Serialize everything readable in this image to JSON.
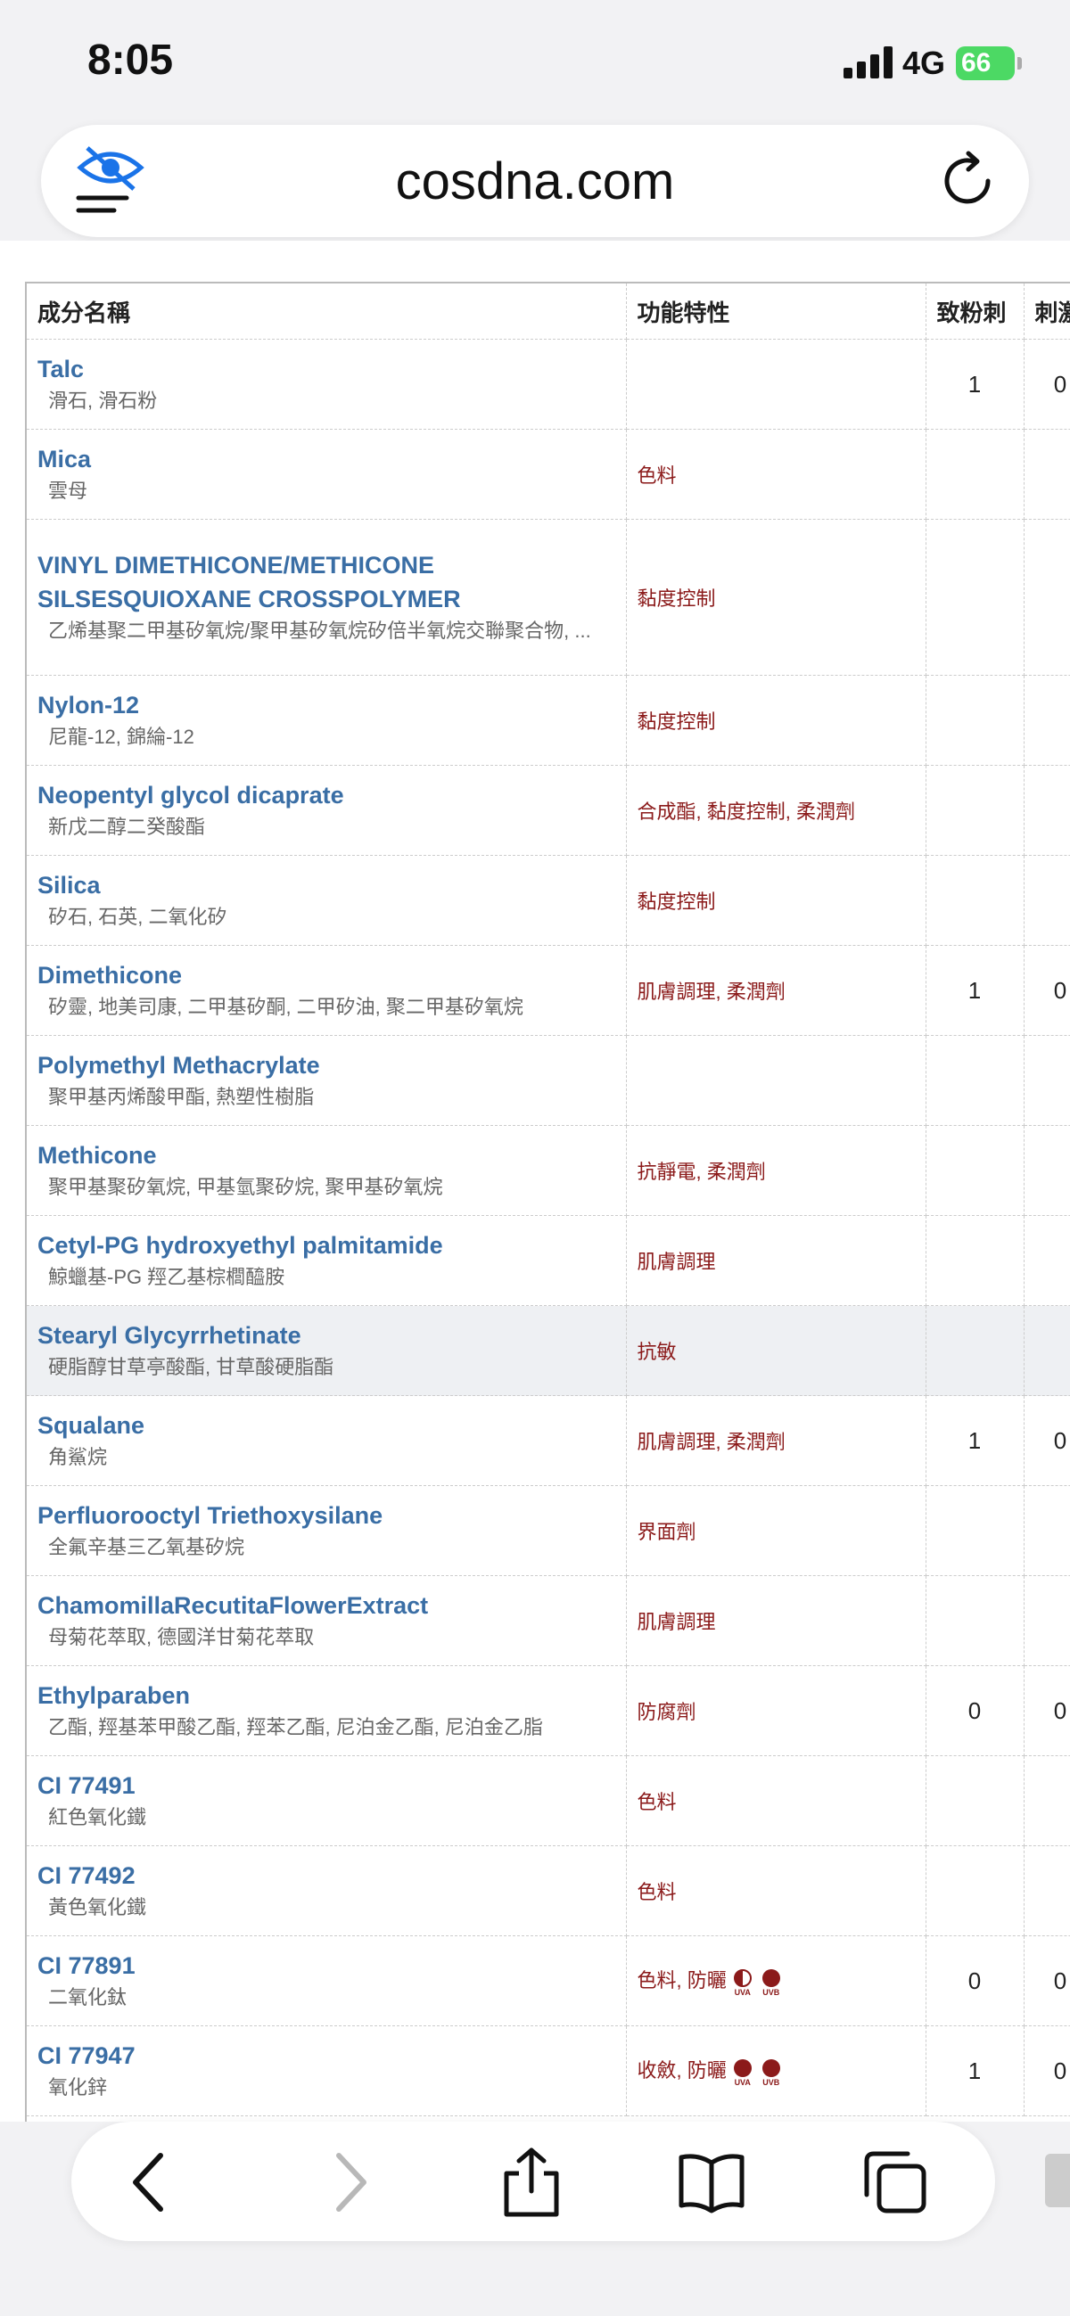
{
  "status": {
    "time": "8:05",
    "network": "4G",
    "battery": "66"
  },
  "browser": {
    "domain": "cosdna.com"
  },
  "table": {
    "headers": [
      "成分名稱",
      "功能特性",
      "致粉刺",
      "刺激"
    ],
    "rows": [
      {
        "name": "Talc",
        "alias": "滑石, 滑石粉",
        "function": "",
        "comedogenic": "1",
        "irritant": "0"
      },
      {
        "name": "Mica",
        "alias": "雲母",
        "function": "色料",
        "comedogenic": "",
        "irritant": ""
      },
      {
        "name": "VINYL DIMETHICONE/METHICONE SILSESQUIOXANE CROSSPOLYMER",
        "alias": "乙烯基聚二甲基矽氧烷/聚甲基矽氧烷矽倍半氧烷交聯聚合物, ...",
        "function": "黏度控制",
        "comedogenic": "",
        "irritant": ""
      },
      {
        "name": "Nylon-12",
        "alias": "尼龍-12, 錦綸-12",
        "function": "黏度控制",
        "comedogenic": "",
        "irritant": ""
      },
      {
        "name": "Neopentyl glycol dicaprate",
        "alias": "新戊二醇二癸酸酯",
        "function": "合成酯, 黏度控制, 柔潤劑",
        "comedogenic": "",
        "irritant": ""
      },
      {
        "name": "Silica",
        "alias": "矽石, 石英, 二氧化矽",
        "function": "黏度控制",
        "comedogenic": "",
        "irritant": ""
      },
      {
        "name": "Dimethicone",
        "alias": "矽靈, 地美司康, 二甲基矽酮, 二甲矽油, 聚二甲基矽氧烷",
        "function": "肌膚調理, 柔潤劑",
        "comedogenic": "1",
        "irritant": "0"
      },
      {
        "name": "Polymethyl Methacrylate",
        "alias": "聚甲基丙烯酸甲酯, 熱塑性樹脂",
        "function": "",
        "comedogenic": "",
        "irritant": ""
      },
      {
        "name": "Methicone",
        "alias": "聚甲基聚矽氧烷, 甲基氫聚矽烷, 聚甲基矽氧烷",
        "function": "抗靜電, 柔潤劑",
        "comedogenic": "",
        "irritant": ""
      },
      {
        "name": "Cetyl-PG hydroxyethyl palmitamide",
        "alias": "鯨蠟基-PG 羥乙基棕櫚醯胺",
        "function": "肌膚調理",
        "comedogenic": "",
        "irritant": ""
      },
      {
        "name": "Stearyl Glycyrrhetinate",
        "alias": "硬脂醇甘草亭酸酯, 甘草酸硬脂酯",
        "function": "抗敏",
        "comedogenic": "",
        "irritant": ""
      },
      {
        "name": "Squalane",
        "alias": "角鯊烷",
        "function": "肌膚調理, 柔潤劑",
        "comedogenic": "1",
        "irritant": "0"
      },
      {
        "name": "Perfluorooctyl Triethoxysilane",
        "alias": "全氟辛基三乙氧基矽烷",
        "function": "界面劑",
        "comedogenic": "",
        "irritant": ""
      },
      {
        "name": "ChamomillaRecutitaFlowerExtract",
        "alias": "母菊花萃取, 德國洋甘菊花萃取",
        "function": "肌膚調理",
        "comedogenic": "",
        "irritant": ""
      },
      {
        "name": "Ethylparaben",
        "alias": "乙酯, 羥基苯甲酸乙酯, 羥苯乙酯, 尼泊金乙酯, 尼泊金乙脂",
        "function": "防腐劑",
        "comedogenic": "0",
        "irritant": "0"
      },
      {
        "name": "CI 77491",
        "alias": "紅色氧化鐵",
        "function": "色料",
        "comedogenic": "",
        "irritant": ""
      },
      {
        "name": "CI 77492",
        "alias": "黃色氧化鐵",
        "function": "色料",
        "comedogenic": "",
        "irritant": ""
      },
      {
        "name": "CI 77891",
        "alias": "二氧化鈦",
        "function": "色料, 防曬",
        "comedogenic": "0",
        "irritant": "0"
      },
      {
        "name": "CI 77947",
        "alias": "氧化鋅",
        "function": "收斂, 防曬",
        "comedogenic": "1",
        "irritant": "0"
      }
    ],
    "uv_labels": [
      "UVA",
      "UVB"
    ]
  }
}
